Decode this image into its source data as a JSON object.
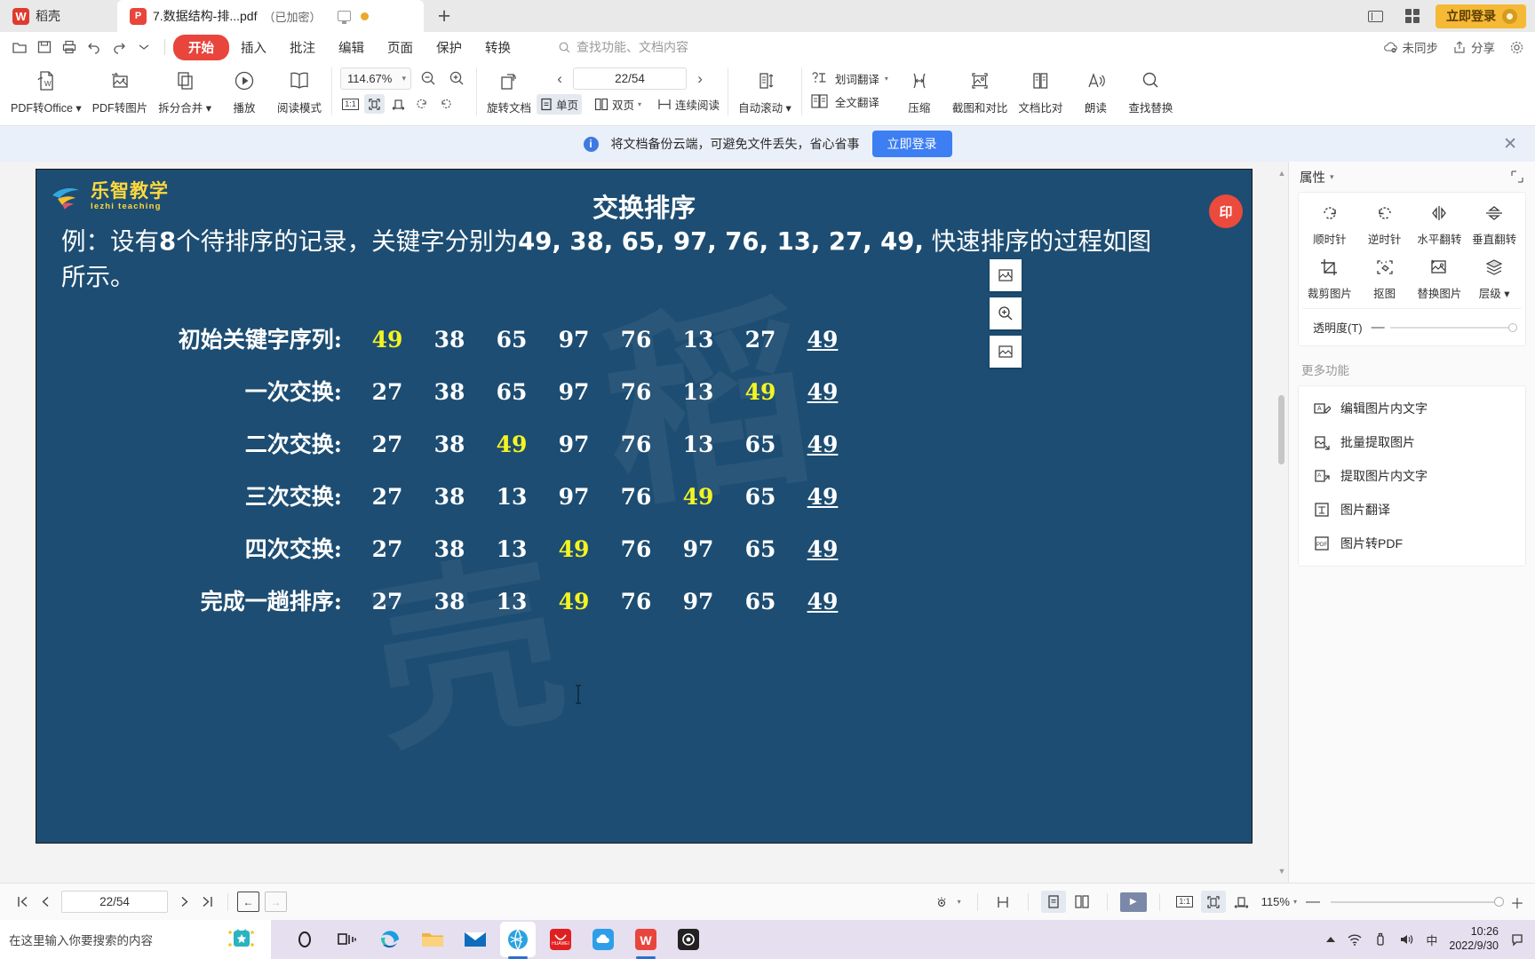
{
  "titlebar": {
    "brand_label": "稻壳",
    "brand_mark": "W",
    "doc_tab": {
      "name": "7.数据结构-排...pdf",
      "encrypted": "（已加密）",
      "icon": "pdf-icon"
    },
    "new_tab": "+",
    "login_button": "立即登录"
  },
  "menu": {
    "quick_icons": [
      "open-icon",
      "save-icon",
      "print-icon",
      "undo-icon",
      "redo-icon",
      "customize-icon"
    ],
    "items": [
      {
        "label": "开始",
        "active": true
      },
      {
        "label": "插入",
        "active": false
      },
      {
        "label": "批注",
        "active": false
      },
      {
        "label": "编辑",
        "active": false
      },
      {
        "label": "页面",
        "active": false
      },
      {
        "label": "保护",
        "active": false
      },
      {
        "label": "转换",
        "active": false
      }
    ],
    "search_placeholder": "查找功能、文档内容",
    "sync_status": "未同步",
    "share": "分享",
    "settings_icon": "gear-icon"
  },
  "ribbon": {
    "buttons": [
      {
        "label": "PDF转Office",
        "icon": "pdf-to-office-icon",
        "dropdown": true
      },
      {
        "label": "PDF转图片",
        "icon": "pdf-to-image-icon",
        "dropdown": false
      },
      {
        "label": "拆分合并",
        "icon": "split-merge-icon",
        "dropdown": true
      },
      {
        "label": "播放",
        "icon": "play-icon",
        "dropdown": false
      },
      {
        "label": "阅读模式",
        "icon": "read-mode-icon",
        "dropdown": false
      }
    ],
    "zoom": {
      "value": "114.67%",
      "zoom_out_icon": "zoom-out-icon",
      "zoom_in_icon": "zoom-in-icon",
      "fit_actual": "1:1",
      "fit_page_icon": "fit-page-icon",
      "fit_width_icon": "fit-width-icon",
      "rotate_cw_icon": "rotate-cw-icon",
      "rotate_ccw_icon": "rotate-ccw-icon"
    },
    "rotate_doc": {
      "label": "旋转文档",
      "icon": "rotate-document-icon"
    },
    "page_nav": {
      "value": "22/54",
      "prev": "‹",
      "next": "›"
    },
    "view_modes": [
      {
        "label": "单页",
        "icon": "single-page-icon",
        "selected": true
      },
      {
        "label": "双页",
        "icon": "dual-page-icon",
        "selected": false,
        "dropdown": true
      },
      {
        "label": "连续阅读",
        "icon": "continuous-scroll-icon",
        "selected": false
      }
    ],
    "auto_scroll": {
      "label": "自动滚动",
      "icon": "auto-scroll-icon",
      "dropdown": true
    },
    "translate_word": {
      "label": "划词翻译",
      "icon": "word-translate-icon",
      "dropdown": true
    },
    "translate_all": {
      "label": "全文翻译",
      "icon": "full-translate-icon"
    },
    "right_buttons": [
      {
        "label": "压缩",
        "icon": "compress-icon"
      },
      {
        "label": "截图和对比",
        "icon": "screenshot-compare-icon"
      },
      {
        "label": "文档比对",
        "icon": "document-compare-icon"
      },
      {
        "label": "朗读",
        "icon": "read-aloud-icon"
      },
      {
        "label": "查找替换",
        "icon": "find-replace-icon"
      }
    ]
  },
  "notice": {
    "icon": "info-icon",
    "text": "将文档备份云端，可避免文件丢失，省心省事",
    "cta": "立即登录",
    "close_icon": "close-icon"
  },
  "document": {
    "logo": {
      "cn": "乐智教学",
      "en": "lezhi teaching"
    },
    "title": "交换排序",
    "example_prefix": "例：设有",
    "example_line": "例：设有8个待排序的记录，关键字分别为49, 38, 65, 97, 76, 13, 27, 49, 快速排序的过程如图所示。",
    "example_bold_count": "8",
    "example_keys": "49, 38, 65, 97, 76, 13, 27, 49,",
    "watermark": "稻壳",
    "steps": [
      {
        "label": "初始关键字序列:",
        "cells": [
          {
            "v": "49",
            "hl": true,
            "ul": false
          },
          {
            "v": "38",
            "hl": false,
            "ul": false
          },
          {
            "v": "65",
            "hl": false,
            "ul": false
          },
          {
            "v": "97",
            "hl": false,
            "ul": false
          },
          {
            "v": "76",
            "hl": false,
            "ul": false
          },
          {
            "v": "13",
            "hl": false,
            "ul": false
          },
          {
            "v": "27",
            "hl": false,
            "ul": false
          },
          {
            "v": "49",
            "hl": false,
            "ul": true
          }
        ]
      },
      {
        "label": "一次交换:",
        "cells": [
          {
            "v": "27",
            "hl": false,
            "ul": false
          },
          {
            "v": "38",
            "hl": false,
            "ul": false
          },
          {
            "v": "65",
            "hl": false,
            "ul": false
          },
          {
            "v": "97",
            "hl": false,
            "ul": false
          },
          {
            "v": "76",
            "hl": false,
            "ul": false
          },
          {
            "v": "13",
            "hl": false,
            "ul": false
          },
          {
            "v": "49",
            "hl": true,
            "ul": false
          },
          {
            "v": "49",
            "hl": false,
            "ul": true
          }
        ]
      },
      {
        "label": "二次交换:",
        "cells": [
          {
            "v": "27",
            "hl": false,
            "ul": false
          },
          {
            "v": "38",
            "hl": false,
            "ul": false
          },
          {
            "v": "49",
            "hl": true,
            "ul": false
          },
          {
            "v": "97",
            "hl": false,
            "ul": false
          },
          {
            "v": "76",
            "hl": false,
            "ul": false
          },
          {
            "v": "13",
            "hl": false,
            "ul": false
          },
          {
            "v": "65",
            "hl": false,
            "ul": false
          },
          {
            "v": "49",
            "hl": false,
            "ul": true
          }
        ]
      },
      {
        "label": "三次交换:",
        "cells": [
          {
            "v": "27",
            "hl": false,
            "ul": false
          },
          {
            "v": "38",
            "hl": false,
            "ul": false
          },
          {
            "v": "13",
            "hl": false,
            "ul": false
          },
          {
            "v": "97",
            "hl": false,
            "ul": false
          },
          {
            "v": "76",
            "hl": false,
            "ul": false
          },
          {
            "v": "49",
            "hl": true,
            "ul": false
          },
          {
            "v": "65",
            "hl": false,
            "ul": false
          },
          {
            "v": "49",
            "hl": false,
            "ul": true
          }
        ]
      },
      {
        "label": "四次交换:",
        "cells": [
          {
            "v": "27",
            "hl": false,
            "ul": false
          },
          {
            "v": "38",
            "hl": false,
            "ul": false
          },
          {
            "v": "13",
            "hl": false,
            "ul": false
          },
          {
            "v": "49",
            "hl": true,
            "ul": false
          },
          {
            "v": "76",
            "hl": false,
            "ul": false
          },
          {
            "v": "97",
            "hl": false,
            "ul": false
          },
          {
            "v": "65",
            "hl": false,
            "ul": false
          },
          {
            "v": "49",
            "hl": false,
            "ul": true
          }
        ]
      },
      {
        "label": "完成一趟排序:",
        "cells": [
          {
            "v": "27",
            "hl": false,
            "ul": false
          },
          {
            "v": "38",
            "hl": false,
            "ul": false
          },
          {
            "v": "13",
            "hl": false,
            "ul": false
          },
          {
            "v": "49",
            "hl": true,
            "ul": false
          },
          {
            "v": "76",
            "hl": false,
            "ul": false
          },
          {
            "v": "97",
            "hl": false,
            "ul": false
          },
          {
            "v": "65",
            "hl": false,
            "ul": false
          },
          {
            "v": "49",
            "hl": false,
            "ul": true
          }
        ]
      }
    ],
    "float_tools": [
      "insert-image-icon",
      "zoom-region-icon",
      "print-region-icon"
    ],
    "badge": "印"
  },
  "properties_panel": {
    "title": "属性",
    "tools": [
      {
        "label": "顺时针",
        "icon": "rotate-clockwise-icon"
      },
      {
        "label": "逆时针",
        "icon": "rotate-counterclockwise-icon"
      },
      {
        "label": "水平翻转",
        "icon": "flip-horizontal-icon"
      },
      {
        "label": "垂直翻转",
        "icon": "flip-vertical-icon"
      },
      {
        "label": "裁剪图片",
        "icon": "crop-image-icon"
      },
      {
        "label": "抠图",
        "icon": "cutout-icon"
      },
      {
        "label": "替换图片",
        "icon": "replace-image-icon"
      },
      {
        "label": "层级",
        "icon": "layer-icon"
      }
    ],
    "opacity_label": "透明度(T)",
    "more_title": "更多功能",
    "more_items": [
      {
        "label": "编辑图片内文字",
        "icon": "edit-image-text-icon"
      },
      {
        "label": "批量提取图片",
        "icon": "batch-extract-image-icon"
      },
      {
        "label": "提取图片内文字",
        "icon": "extract-image-text-icon"
      },
      {
        "label": "图片翻译",
        "icon": "image-translate-icon"
      },
      {
        "label": "图片转PDF",
        "icon": "image-to-pdf-icon"
      }
    ]
  },
  "bottombar": {
    "first_icon": "first-page-icon",
    "prev_icon": "prev-page-icon",
    "page_value": "22/54",
    "next_icon": "next-page-icon",
    "last_icon": "last-page-icon",
    "back_icon": "←",
    "forward_icon": "→",
    "eye_icon": "view-mode-icon",
    "fit_icon": "fit-height-icon",
    "single_icon": "single-page-icon",
    "dual_icon": "dual-page-icon",
    "play_icon": "play-icon",
    "actual_size": "1:1",
    "fit_page_icon": "fit-page-icon",
    "fit_width_icon": "fit-width-icon",
    "zoom_value": "115%"
  },
  "taskbar": {
    "search_placeholder": "在这里输入你要搜索的内容",
    "search_icon": "search-icon",
    "tv_icon": "tv-widget-icon",
    "apps": [
      {
        "name": "cortana-icon"
      },
      {
        "name": "task-view-icon"
      },
      {
        "name": "edge-icon"
      },
      {
        "name": "file-explorer-icon"
      },
      {
        "name": "mail-icon"
      },
      {
        "name": "browser-icon"
      },
      {
        "name": "huawei-icon"
      },
      {
        "name": "cloud-icon"
      },
      {
        "name": "wps-icon"
      },
      {
        "name": "camera-icon"
      }
    ],
    "tray": {
      "chevron_icon": "chevron-up-icon",
      "network_icon": "network-icon",
      "usb_icon": "usb-icon",
      "volume_icon": "volume-icon",
      "ime": "中",
      "time": "10:26",
      "date": "2022/9/30",
      "notify_icon": "notification-icon"
    }
  }
}
